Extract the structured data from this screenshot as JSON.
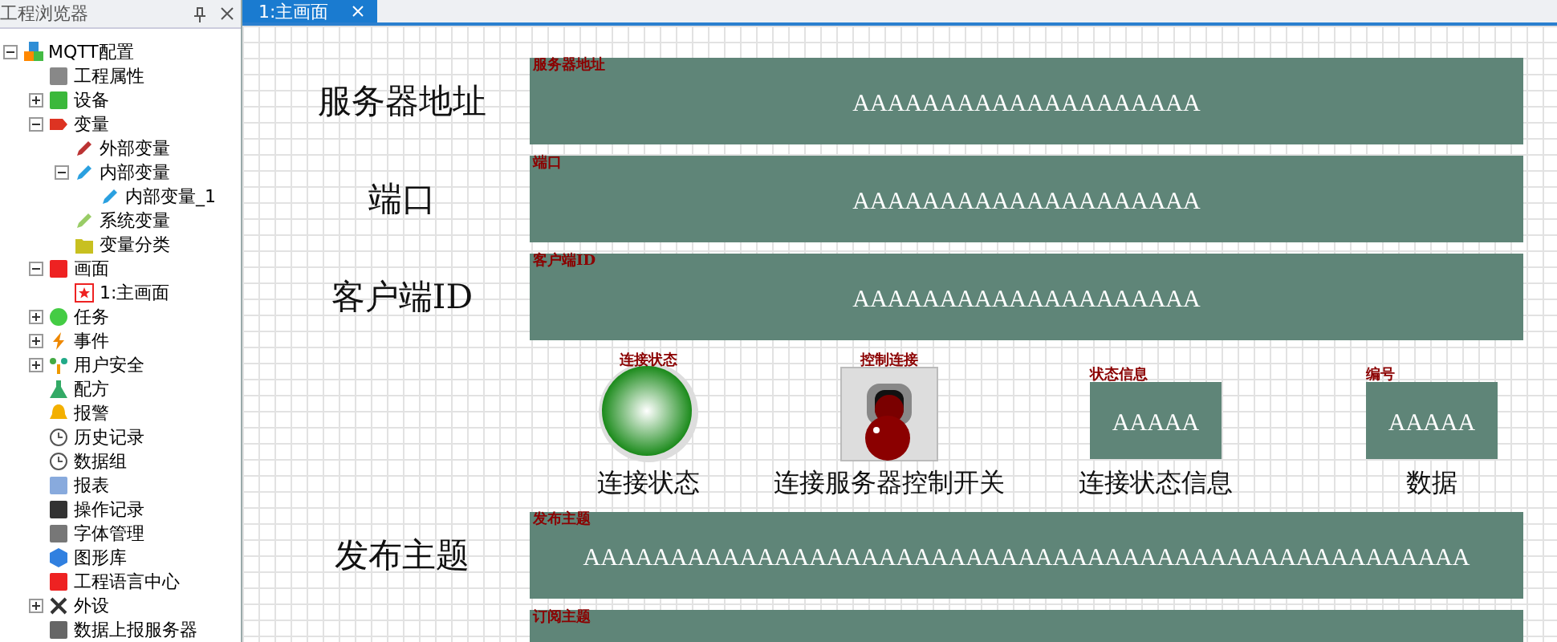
{
  "explorer": {
    "title": "工程浏览器",
    "tree": [
      {
        "label": "MQTT配置",
        "kind": "project",
        "expanded": true,
        "children": [
          {
            "label": "工程属性",
            "kind": "property"
          },
          {
            "label": "设备",
            "kind": "device",
            "expanded": false
          },
          {
            "label": "变量",
            "kind": "variable",
            "expanded": true,
            "children": [
              {
                "label": "外部变量",
                "kind": "tag-red"
              },
              {
                "label": "内部变量",
                "kind": "tag-blue",
                "expanded": true,
                "children": [
                  {
                    "label": "内部变量_1",
                    "kind": "tag-blue"
                  }
                ]
              },
              {
                "label": "系统变量",
                "kind": "tag-green"
              },
              {
                "label": "变量分类",
                "kind": "folder"
              }
            ]
          },
          {
            "label": "画面",
            "kind": "screen",
            "expanded": true,
            "children": [
              {
                "label": "1:主画面",
                "kind": "page"
              }
            ]
          },
          {
            "label": "任务",
            "kind": "task",
            "expanded": false
          },
          {
            "label": "事件",
            "kind": "event",
            "expanded": false
          },
          {
            "label": "用户安全",
            "kind": "users",
            "expanded": false
          },
          {
            "label": "配方",
            "kind": "recipe"
          },
          {
            "label": "报警",
            "kind": "alarm"
          },
          {
            "label": "历史记录",
            "kind": "clock"
          },
          {
            "label": "数据组",
            "kind": "clock"
          },
          {
            "label": "报表",
            "kind": "report"
          },
          {
            "label": "操作记录",
            "kind": "log"
          },
          {
            "label": "字体管理",
            "kind": "font"
          },
          {
            "label": "图形库",
            "kind": "gallery"
          },
          {
            "label": "工程语言中心",
            "kind": "language"
          },
          {
            "label": "外设",
            "kind": "peripheral",
            "expanded": false
          },
          {
            "label": "数据上报服务器",
            "kind": "server"
          }
        ]
      }
    ]
  },
  "tabs": [
    {
      "label": "1:主画面",
      "selected": true
    }
  ],
  "screen": {
    "rows": [
      {
        "kind": "field",
        "label": "服务器地址",
        "caption": "服务器地址",
        "value": "AAAAAAAAAAAAAAAAAAAA"
      },
      {
        "kind": "field",
        "label": "端口",
        "caption": "端口",
        "value": "AAAAAAAAAAAAAAAAAAAA"
      },
      {
        "kind": "field",
        "label": "客户端ID",
        "caption": "客户端ID",
        "value": "AAAAAAAAAAAAAAAAAAAA"
      },
      {
        "kind": "widgets",
        "items": [
          {
            "kind": "lamp",
            "on": true,
            "caption": "连接状态",
            "label": "连接状态"
          },
          {
            "kind": "toggle",
            "caption": "控制连接",
            "label": "连接服务器控制开关"
          },
          {
            "kind": "display",
            "caption": "状态信息",
            "value": "AAAAA",
            "label": "连接状态信息"
          },
          {
            "kind": "display",
            "caption": "编号",
            "value": "AAAAA",
            "label": "数据"
          }
        ]
      },
      {
        "kind": "field",
        "label": "发布主题",
        "caption": "发布主题",
        "value": "AAAAAAAAAAAAAAAAAAAAAAAAAAAAAAAAAAAAAAAAAAAAAAAAAAA"
      },
      {
        "kind": "field",
        "caption": "订阅主题"
      }
    ]
  }
}
